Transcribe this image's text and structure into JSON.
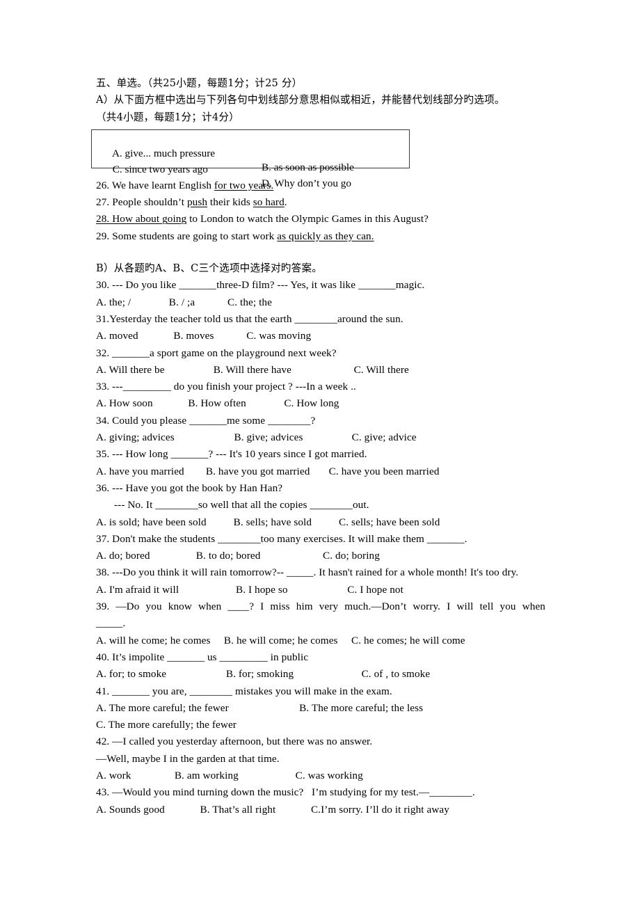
{
  "document": {
    "section_heading": "五、单选。（共25小题，每题1分；计25 分）",
    "part_a": {
      "instruction_line1": "A）从下面方框中选出与下列各句中划线部分意思相似或相近，并能替代划线部分旳选项。",
      "instruction_line2": "（共4小题，每题1分；计4分）",
      "choice_box": {
        "a": "A. give... much pressure",
        "b": "B. as soon as possible",
        "c": "C. since two years ago",
        "d": "D. Why don’t you go"
      },
      "questions": [
        {
          "number": "26.",
          "pre": " We have learnt English ",
          "underlined": "for two years.",
          "post": ""
        },
        {
          "number": "27.",
          "pre": " People shouldn’t ",
          "underlined": "push",
          "mid": " their kids ",
          "underlined2": "so hard",
          "post": "."
        },
        {
          "number": "28.",
          "pre": " ",
          "underlined": "How about going",
          "post": " to London to watch the Olympic Games in this August?"
        },
        {
          "number": "29.",
          "pre": " Some students are going to start work ",
          "underlined": "as quickly as they can.",
          "post": ""
        }
      ]
    },
    "part_b": {
      "instruction": "B）从各题旳A、B、C三个选项中选择对旳答案。",
      "items": [
        {
          "stem": "30. --- Do you like _______three-D film? --- Yes, it was like _______magic.",
          "options": "A. the; /              B. / ;a            C. the; the"
        },
        {
          "stem": "31.Yesterday the teacher told us that the earth ________around the sun.",
          "options": "A. moved             B. moves            C. was moving"
        },
        {
          "stem": "32. _______a sport game on the playground next week?",
          "options": "A. Will there be                  B. Will there have                       C. Will there"
        },
        {
          "stem": "33. ---_________ do you finish your project ? ---In a week ..",
          "options": "A. How soon             B. How often              C. How long"
        },
        {
          "stem": "34. Could you please _______me some ________?",
          "options": "A. giving; advices                      B. give; advices                  C. give; advice"
        },
        {
          "stem": "35. --- How long _______? --- It's 10 years since I got married.",
          "options": "A. have you married        B. have you got married       C. have you been married"
        },
        {
          "stem": "36. --- Have you got the book by Han Han?",
          "stem2": "--- No. It ________so well that all the copies ________out.",
          "options": "A. is sold; have been sold          B. sells; have sold          C. sells; have been sold"
        },
        {
          "stem": "37. Don't make the students ________too many exercises. It will make them _______.",
          "options": "A. do; bored                 B. to do; bored                       C. do; boring"
        },
        {
          "stem": "38. ---Do you think it will rain tomorrow?-- _____. It hasn't rained for a whole month! It's too dry.",
          "options": "A. I'm afraid it will                     B. I hope so                      C. I hope not"
        },
        {
          "stem": "39. —Do you know when ____? I miss him very much.—Don’t worry. I will tell you when",
          "stem2": "_____.",
          "options": "A. will he come; he comes     B. he will come; he comes     C. he comes; he will come"
        },
        {
          "stem": "40. It’s impolite _______ us _________ in public",
          "options": "A. for; to smoke                      B. for; smoking                         C. of , to smoke"
        },
        {
          "stem": "41. _______ you are, ________ mistakes you will make in the exam.",
          "options": "A. The more careful; the fewer                          B. The more careful; the less",
          "options2": "C. The more carefully; the fewer"
        },
        {
          "stem": "42. —I called you yesterday afternoon, but there was no answer.",
          "stem2": "—Well, maybe I in the garden at that time.",
          "options": "A. work                B. am working                     C. was working"
        },
        {
          "stem": "43. —Would you mind turning down the music?   I’m studying for my test.—________.",
          "options": "A. Sounds good             B. That’s all right             C.I’m sorry. I’ll do it right away"
        }
      ]
    }
  }
}
